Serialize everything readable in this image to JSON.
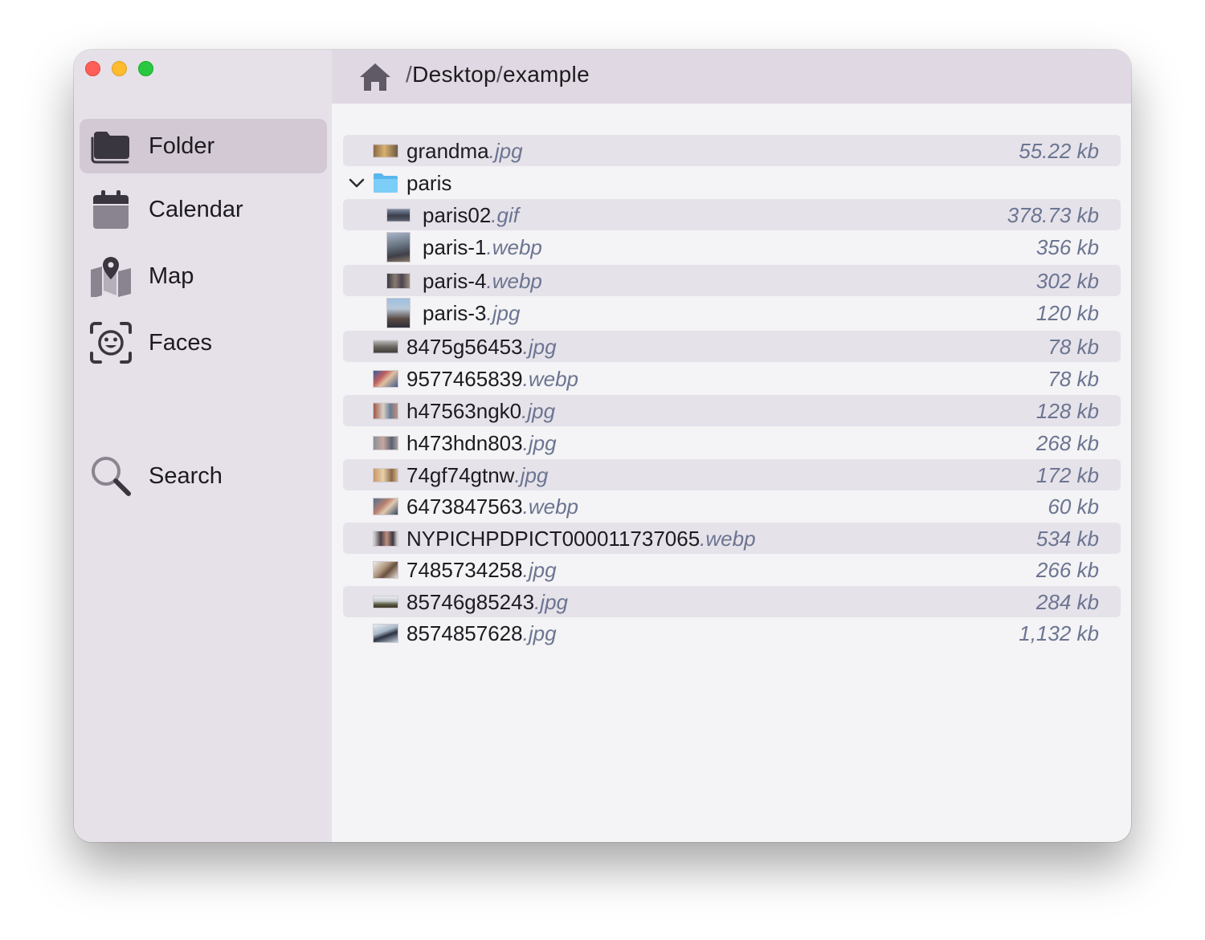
{
  "window": {
    "controls": [
      "close",
      "minimize",
      "zoom"
    ]
  },
  "sidebar": {
    "items": [
      {
        "label": "Folder",
        "icon": "folder-icon",
        "active": true
      },
      {
        "label": "Calendar",
        "icon": "calendar-icon",
        "active": false
      },
      {
        "label": "Map",
        "icon": "map-icon",
        "active": false
      },
      {
        "label": "Faces",
        "icon": "faces-icon",
        "active": false
      },
      {
        "label": "Search",
        "icon": "search-icon",
        "active": false
      }
    ]
  },
  "pathbar": {
    "home_icon": "home-icon",
    "segments": [
      "Desktop",
      "example"
    ],
    "separator": "/"
  },
  "files": [
    {
      "name": "grandma",
      "ext": ".jpg",
      "size": "55.22 kb",
      "type": "image",
      "depth": 0
    },
    {
      "name": "paris",
      "ext": "",
      "size": "",
      "type": "folder",
      "depth": 0,
      "expanded": true
    },
    {
      "name": "paris02",
      "ext": ".gif",
      "size": "378.73 kb",
      "type": "image",
      "depth": 1
    },
    {
      "name": "paris-1",
      "ext": ".webp",
      "size": "356 kb",
      "type": "image",
      "depth": 1
    },
    {
      "name": "paris-4",
      "ext": ".webp",
      "size": "302 kb",
      "type": "image",
      "depth": 1
    },
    {
      "name": "paris-3",
      "ext": ".jpg",
      "size": "120 kb",
      "type": "image",
      "depth": 1
    },
    {
      "name": "8475g56453",
      "ext": ".jpg",
      "size": "78 kb",
      "type": "image",
      "depth": 0
    },
    {
      "name": "9577465839",
      "ext": ".webp",
      "size": "78 kb",
      "type": "image",
      "depth": 0
    },
    {
      "name": "h47563ngk0",
      "ext": ".jpg",
      "size": "128 kb",
      "type": "image",
      "depth": 0
    },
    {
      "name": "h473hdn803",
      "ext": ".jpg",
      "size": "268 kb",
      "type": "image",
      "depth": 0
    },
    {
      "name": "74gf74gtnw",
      "ext": ".jpg",
      "size": "172 kb",
      "type": "image",
      "depth": 0
    },
    {
      "name": "6473847563",
      "ext": ".webp",
      "size": "60 kb",
      "type": "image",
      "depth": 0
    },
    {
      "name": "NYPICHPDPICT000011737065",
      "ext": ".webp",
      "size": "534 kb",
      "type": "image",
      "depth": 0
    },
    {
      "name": "7485734258",
      "ext": ".jpg",
      "size": "266 kb",
      "type": "image",
      "depth": 0
    },
    {
      "name": "85746g85243",
      "ext": ".jpg",
      "size": "284 kb",
      "type": "image",
      "depth": 0
    },
    {
      "name": "8574857628",
      "ext": ".jpg",
      "size": "1,132 kb",
      "type": "image",
      "depth": 0
    }
  ],
  "colors": {
    "sidebar_bg": "#e6e1e8",
    "sidebar_active": "#d2c9d4",
    "pathbar_bg": "#e0d8e2",
    "content_bg": "#f4f3f5",
    "row_stripe": "#e6e2ea",
    "ext_color": "#6b7591",
    "folder_blue": "#6cc4f5"
  }
}
